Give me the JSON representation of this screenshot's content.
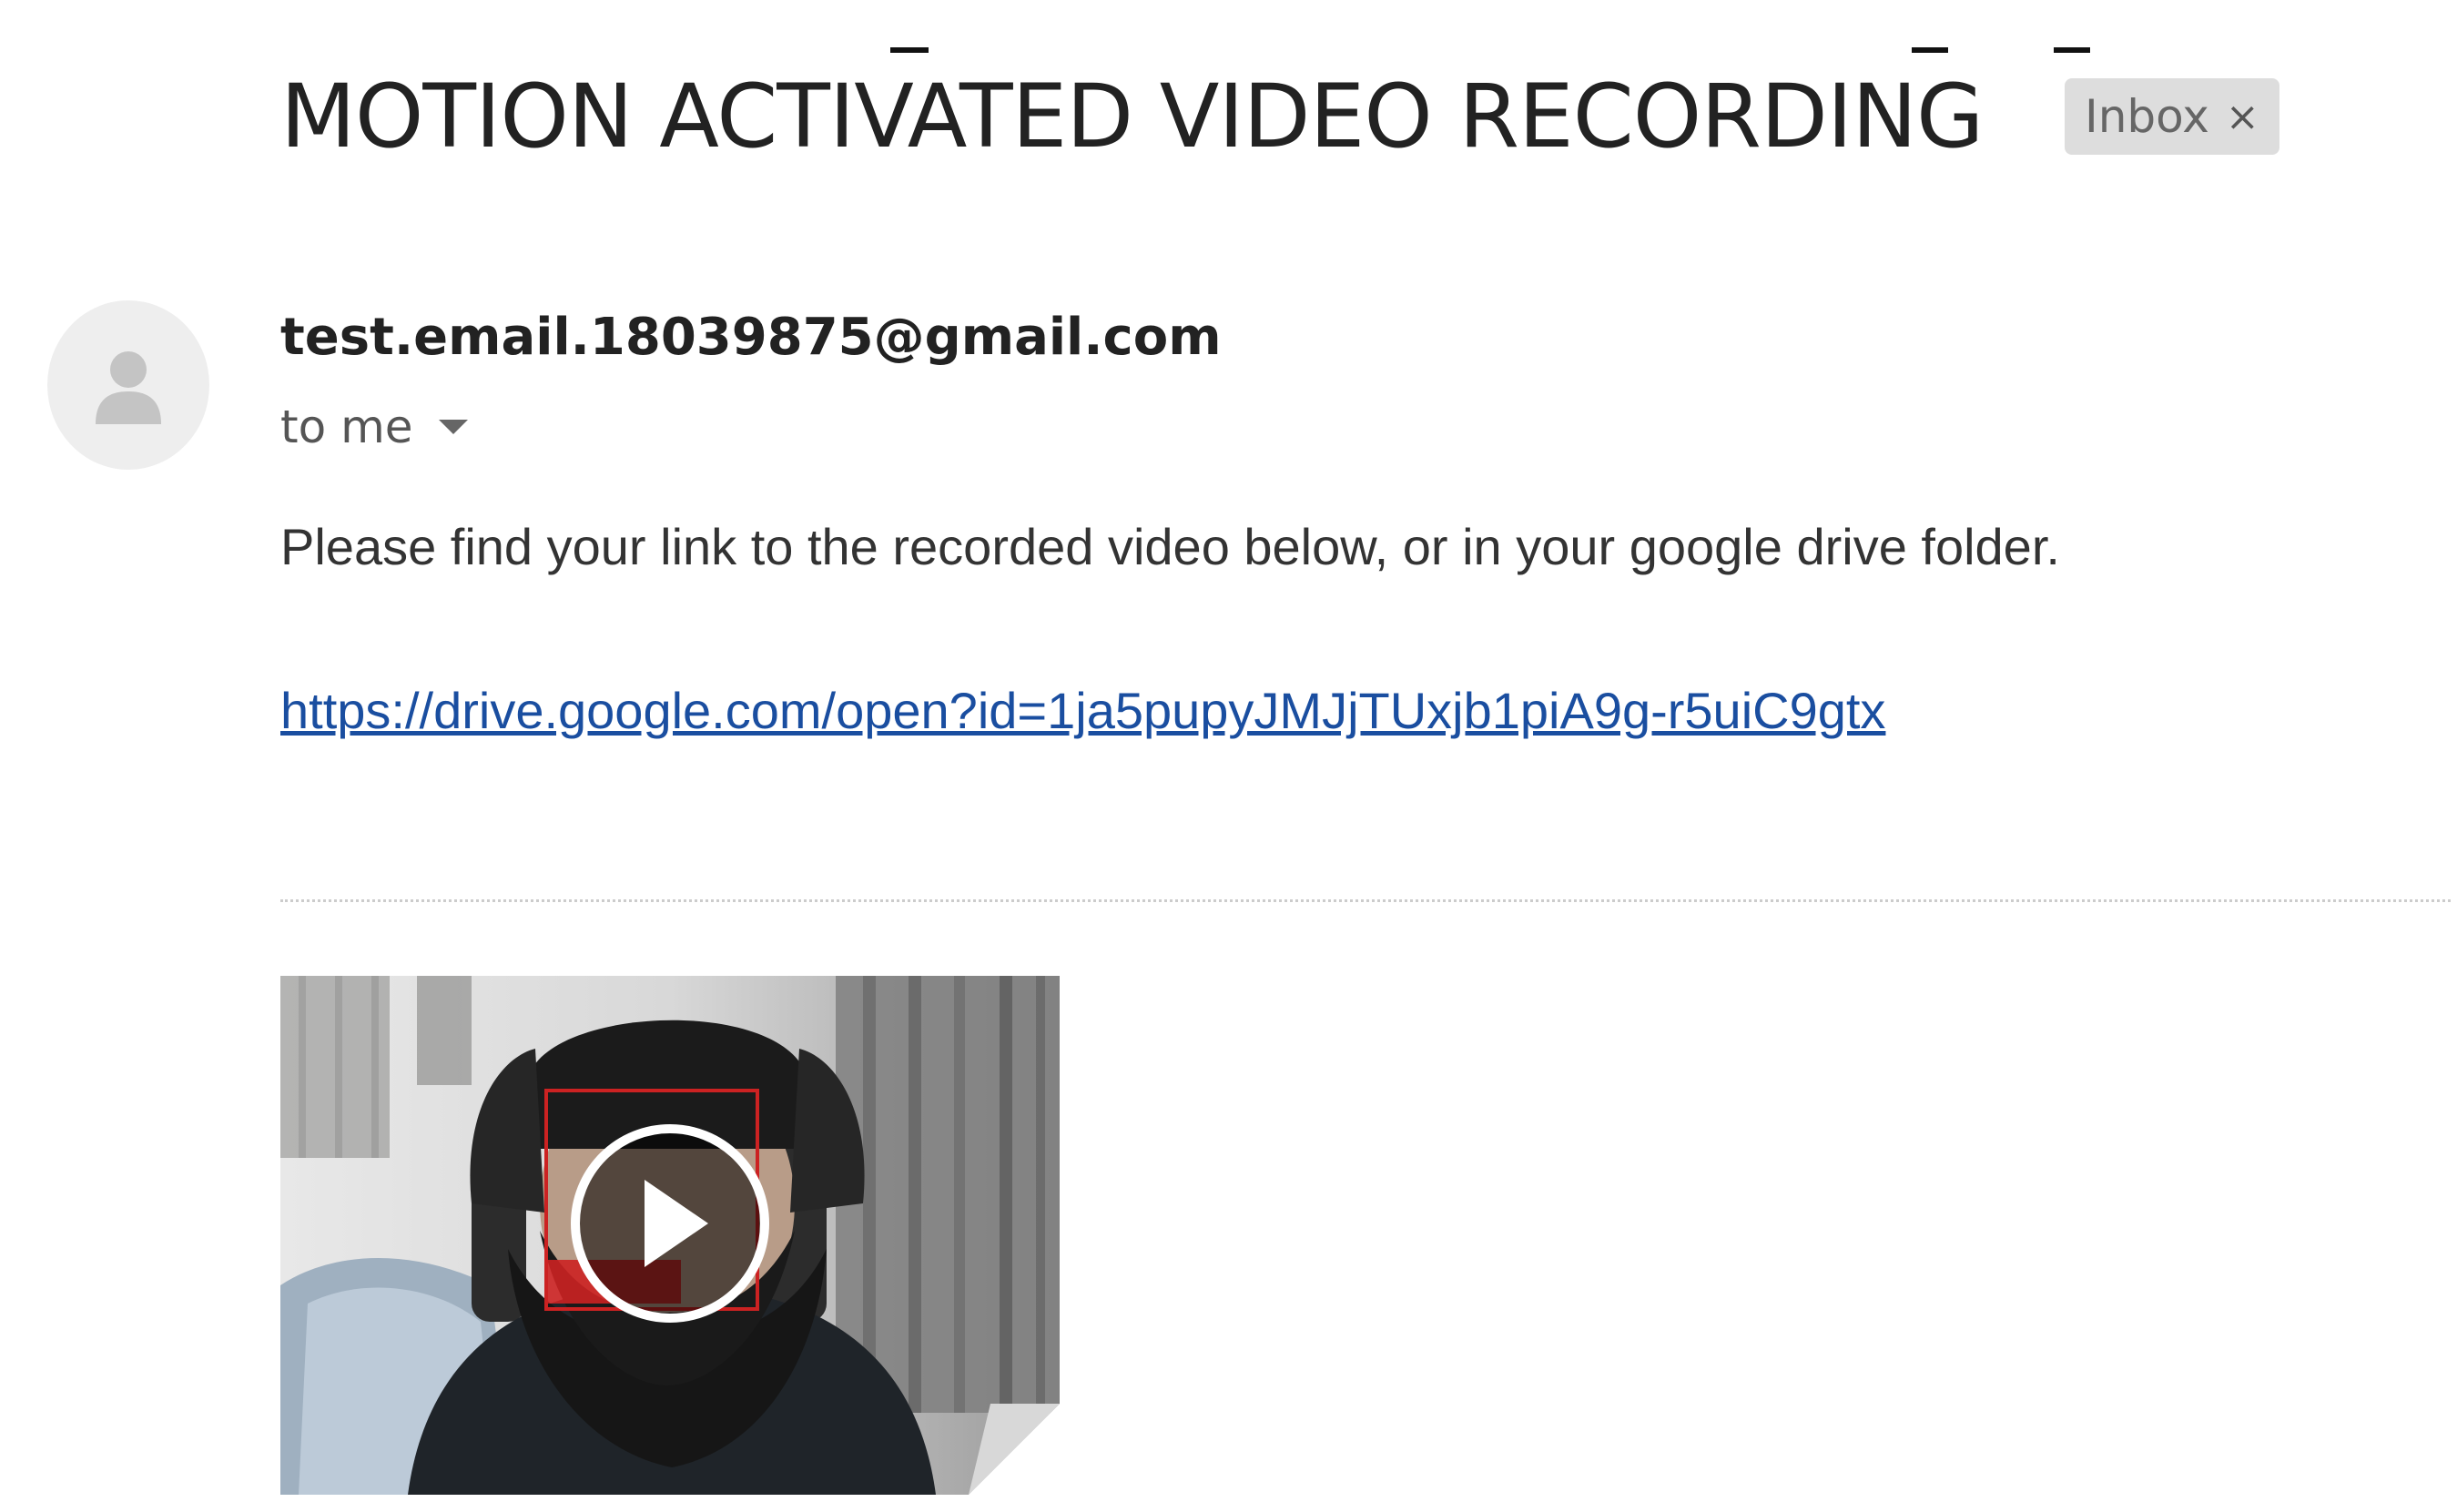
{
  "email": {
    "subject": "MOTION ACTIVATED VIDEO RECORDING",
    "label": "Inbox",
    "label_close_glyph": "×",
    "sender": "test.email.18039875@gmail.com",
    "recipient": "to me",
    "body": "Please find your link to the recorded video below, or in your google drive folder.",
    "link": "https://drive.google.com/open?id=1ja5pupyJMJjTUxjb1piA9g-r5uiC9gtx"
  },
  "icons": {
    "avatar": "person-icon",
    "recipient_toggle": "caret-down-icon",
    "label_remove": "close-icon",
    "video_play": "play-icon"
  },
  "colors": {
    "link": "#1a4ea0",
    "chip_background": "#dddddd",
    "face_box": "#cc2222"
  }
}
